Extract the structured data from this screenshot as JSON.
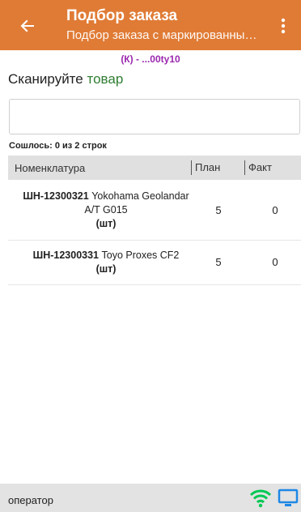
{
  "header": {
    "title": "Подбор заказа",
    "subtitle": "Подбор заказа с маркированным товаром",
    "back_icon": "arrow-left-icon",
    "menu_icon": "more-vert-icon",
    "color": "#e07b35"
  },
  "doc_code": "(К) - ...00ty10",
  "prompt": {
    "prefix": "Сканируйте ",
    "highlight": "товар"
  },
  "scan_input": {
    "value": "",
    "placeholder": ""
  },
  "found_label": "Сошлось: 0 из 2 строк",
  "table": {
    "columns": [
      "Номенклатура",
      "План",
      "Факт"
    ],
    "rows": [
      {
        "code": "ШН-12300321",
        "name": " Yokohama Geolandar A/T G015",
        "unit": "(шт)",
        "plan": "5",
        "fact": "0"
      },
      {
        "code": "ШН-12300331",
        "name": " Toyo Proxes CF2",
        "unit": "(шт)",
        "plan": "5",
        "fact": "0"
      }
    ]
  },
  "status": {
    "user": "оператор",
    "wifi_icon": "wifi-icon",
    "monitor_icon": "monitor-icon",
    "icon_color": "#00c853",
    "monitor_color": "#1e88e5"
  }
}
